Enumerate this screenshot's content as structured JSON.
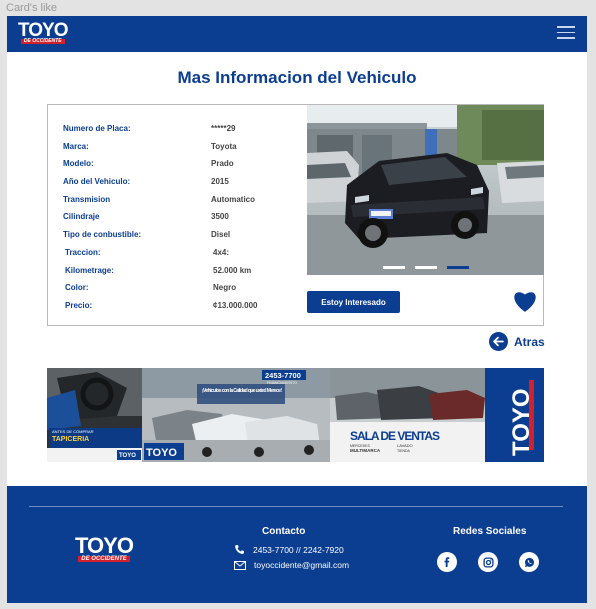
{
  "frame_label": "Card's like",
  "brand": {
    "name": "TOYO",
    "tagline": "DE OCCIDENTE",
    "primary_color": "#0b3d91",
    "accent_color": "#d4202a"
  },
  "navbar": {
    "menu_icon": "hamburger-menu-icon"
  },
  "page": {
    "title": "Mas Informacion del Vehiculo"
  },
  "vehicle": {
    "specs": [
      {
        "label": "Numero de Placa:",
        "value": "*****29"
      },
      {
        "label": "Marca:",
        "value": "Toyota"
      },
      {
        "label": "Modelo:",
        "value": "Prado"
      },
      {
        "label": "Año del Vehiculo:",
        "value": "2015"
      },
      {
        "label": "Transmision",
        "value": "Automatico"
      },
      {
        "label": "Cilindraje",
        "value": "3500"
      },
      {
        "label": "Tipo de conbustible:",
        "value": "Disel"
      },
      {
        "label": "Traccion:",
        "value": "4x4:"
      },
      {
        "label": "Kilometrage:",
        "value": "52.000 km"
      },
      {
        "label": "Color:",
        "value": "Negro"
      },
      {
        "label": "Precio:",
        "value": "¢13.000.000"
      }
    ],
    "carousel": {
      "slides": 3,
      "active_index": 2
    },
    "interest_button": "Estoy Interesado",
    "favorite_icon": "heart-icon"
  },
  "back": {
    "label": "Atras",
    "icon": "arrow-left-icon"
  },
  "banner": {
    "panel1": {
      "headline": "ANTES DE COMPRAR",
      "title": "TAPICERIA"
    },
    "panel2": {
      "phone": "2453-7700",
      "phone_sub": "FINANCIAMIENTO",
      "text": "¡Vehiculos con la Calidad que usted Merece!"
    },
    "panel3": {
      "title": "SALA DE VENTAS",
      "sub1": "MERCEDES",
      "sub2": "MULTIMARCA",
      "sub3": "LAVADO",
      "sub4": "TIENDA"
    }
  },
  "footer": {
    "contact_title": "Contacto",
    "phone": "2453-7700 // 2242-7920",
    "email": "toyoccidente@gmail.com",
    "social_title": "Redes Sociales",
    "social_icons": [
      "facebook-icon",
      "instagram-icon",
      "whatsapp-icon"
    ]
  }
}
